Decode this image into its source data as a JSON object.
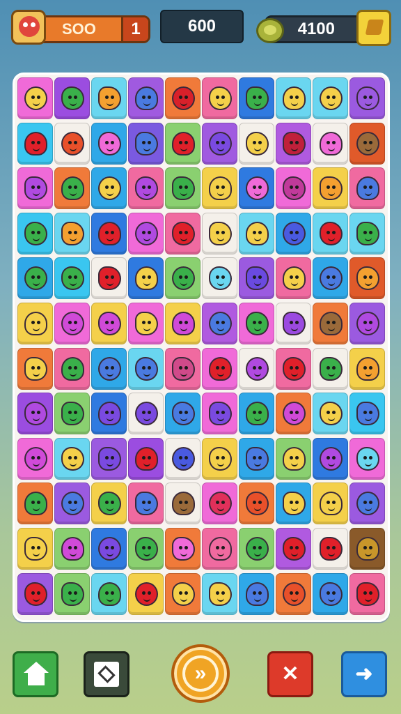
{
  "hud": {
    "left_label": "SOO",
    "left_number": "1",
    "center_value": "600",
    "coins": "4100"
  },
  "buttons": {
    "play_glyph": "»",
    "shuffle_glyph": "✕",
    "next_glyph": "➜"
  },
  "board": {
    "cols": 10,
    "rows": 12,
    "tiles": [
      [
        "#f06ad8",
        "#9b4de0",
        "#6ad6f0",
        "#a05ae0",
        "#f07a3a",
        "#f06aa0",
        "#2f7ae0",
        "#6ad6f0",
        "#6ad6f0",
        "#9b5ae0"
      ],
      [
        "#3ac6f0",
        "#f4f0ea",
        "#2fa8e8",
        "#7a5ae0",
        "#8ad070",
        "#a05ae0",
        "#f4f0ea",
        "#b05ae0",
        "#f4f0ea",
        "#e05a2a"
      ],
      [
        "#f06ad8",
        "#f07a3a",
        "#2fa8e8",
        "#f06aa0",
        "#8ad070",
        "#f4d04a",
        "#2f7ae0",
        "#f06ad8",
        "#f4d04a",
        "#f06aa0"
      ],
      [
        "#3ac6f0",
        "#6ad6f0",
        "#2f7ae0",
        "#f06ad8",
        "#f06aa0",
        "#f4f0ea",
        "#6ad6f0",
        "#2fa8e8",
        "#6ad6f0",
        "#6ad6f0"
      ],
      [
        "#2fa8e8",
        "#3ac6f0",
        "#f4f0ea",
        "#2f7ae0",
        "#8ad070",
        "#f4f0ea",
        "#9b5ae0",
        "#f06aa0",
        "#2fa8e8",
        "#e05a2a"
      ],
      [
        "#f4d04a",
        "#f06ad8",
        "#f4d04a",
        "#f06ad8",
        "#f4d04a",
        "#b05ae0",
        "#f06ad8",
        "#f4f0ea",
        "#f07a3a",
        "#9b5ae0"
      ],
      [
        "#f07a3a",
        "#f06aa0",
        "#2fa8e8",
        "#6ad6f0",
        "#f06aa0",
        "#f06ad8",
        "#f4f0ea",
        "#f06aa0",
        "#f4f0ea",
        "#f4d04a"
      ],
      [
        "#9b4de0",
        "#8ad070",
        "#2f7ae0",
        "#f4f0ea",
        "#2fa8e8",
        "#f06ad8",
        "#2fa8e8",
        "#f07a3a",
        "#6ad6f0",
        "#3ac6f0"
      ],
      [
        "#f06ad8",
        "#6ad6f0",
        "#9b5ae0",
        "#9b4de0",
        "#f4f0ea",
        "#f4d04a",
        "#2fa8e8",
        "#8ad070",
        "#2f7ae0",
        "#f06ad8"
      ],
      [
        "#f07a3a",
        "#9b5ae0",
        "#f4d04a",
        "#f06aa0",
        "#f4f0ea",
        "#f06ad8",
        "#f07a3a",
        "#2fa8e8",
        "#f4d04a",
        "#9b5ae0"
      ],
      [
        "#f4d04a",
        "#8ad070",
        "#2f7ae0",
        "#8ad070",
        "#f07a3a",
        "#f06aa0",
        "#8ad070",
        "#b05ae0",
        "#f4f0ea",
        "#8a5a2a"
      ],
      [
        "#9b5ae0",
        "#8ad070",
        "#6ad6f0",
        "#f4d04a",
        "#f07a3a",
        "#6ad6f0",
        "#2fa8e8",
        "#f07a3a",
        "#2fa8e8",
        "#f06aa0"
      ]
    ],
    "critters": [
      [
        "#f4d04a",
        "#3ab04a",
        "#f4a030",
        "#4a7ae0",
        "#d8202a",
        "#f4d04a",
        "#3ab04a",
        "#f4d04a",
        "#f4d04a",
        "#9b5ae0"
      ],
      [
        "#e0202a",
        "#e8502a",
        "#f06ad8",
        "#4a7ae0",
        "#e0202a",
        "#7a4ae0",
        "#f4d04a",
        "#c0203a",
        "#f06ad8",
        "#9a6a3a"
      ],
      [
        "#b04ae0",
        "#3ab04a",
        "#f4d04a",
        "#b04ae0",
        "#3ab04a",
        "#f4d04a",
        "#f06ad8",
        "#c03a9a",
        "#f4a030",
        "#4a7ae0"
      ],
      [
        "#3ab04a",
        "#f4a030",
        "#e0202a",
        "#b04ae0",
        "#e0202a",
        "#f4d04a",
        "#f4d04a",
        "#4a5ae0",
        "#e0202a",
        "#3ab04a"
      ],
      [
        "#3ab04a",
        "#3ab04a",
        "#e0202a",
        "#f4d04a",
        "#3ab04a",
        "#6ad6f0",
        "#6a4ae0",
        "#f4d04a",
        "#4a7ae0",
        "#f4a030"
      ],
      [
        "#f4d04a",
        "#d04ad8",
        "#d04ad8",
        "#f4d04a",
        "#d04ad8",
        "#4a7ae0",
        "#3ab04a",
        "#9b4ae0",
        "#9a6a3a",
        "#b04ae0"
      ],
      [
        "#f4d04a",
        "#3ab04a",
        "#4a7ae0",
        "#4a7ae0",
        "#d04a8a",
        "#e0202a",
        "#b04ae0",
        "#e0202a",
        "#3ab04a",
        "#f4a030"
      ],
      [
        "#b04ae0",
        "#3ab04a",
        "#7a4ae0",
        "#7a4ae0",
        "#4a7ae0",
        "#7a4ae0",
        "#3ab04a",
        "#d04ad8",
        "#f4d04a",
        "#4a7ae0"
      ],
      [
        "#d04ad8",
        "#f4d04a",
        "#7a4ae0",
        "#e0202a",
        "#4a5ae0",
        "#f4d04a",
        "#4a7ae0",
        "#f4d04a",
        "#b04ae0",
        "#6ad6f0"
      ],
      [
        "#3ab04a",
        "#4a7ae0",
        "#3ab04a",
        "#4a7ae0",
        "#9a6a3a",
        "#e0305a",
        "#e8502a",
        "#f4d04a",
        "#f4d04a",
        "#4a7ae0"
      ],
      [
        "#f4d04a",
        "#d04ad8",
        "#7a4ae0",
        "#3ab04a",
        "#f06ad8",
        "#f06aa0",
        "#3ab04a",
        "#e0202a",
        "#e0202a",
        "#c8962a"
      ],
      [
        "#e0202a",
        "#3ab04a",
        "#3ab04a",
        "#e0202a",
        "#f4d04a",
        "#f4d04a",
        "#4a7ae0",
        "#e8502a",
        "#4a7ae0",
        "#e0202a"
      ]
    ]
  }
}
